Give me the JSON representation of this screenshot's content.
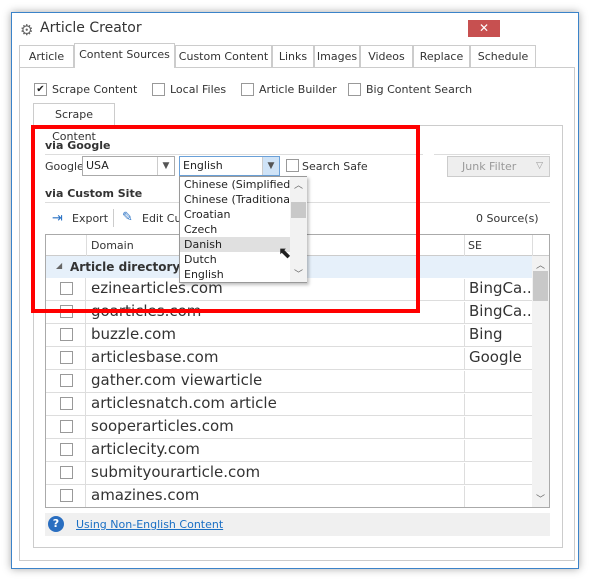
{
  "window": {
    "title": "Article Creator",
    "close_label": "✕"
  },
  "tabs": [
    {
      "label": "Article"
    },
    {
      "label": "Content Sources",
      "active": true
    },
    {
      "label": "Custom Content"
    },
    {
      "label": "Links"
    },
    {
      "label": "Images"
    },
    {
      "label": "Videos"
    },
    {
      "label": "Replace"
    },
    {
      "label": "Schedule"
    }
  ],
  "sources": [
    {
      "label": "Scrape Content",
      "checked": true
    },
    {
      "label": "Local Files",
      "checked": false
    },
    {
      "label": "Article Builder",
      "checked": false
    },
    {
      "label": "Big Content Search",
      "checked": false
    }
  ],
  "subtab": "Scrape Content",
  "google": {
    "section": "via Google",
    "label": "Google",
    "country": "USA",
    "language": "English",
    "search_safe": "Search Safe",
    "junk_filter": "Junk Filter"
  },
  "language_options": [
    "Chinese (Simplified)",
    "Chinese (Traditional)",
    "Croatian",
    "Czech",
    "Danish",
    "Dutch",
    "English"
  ],
  "hovered_option": "Danish",
  "custom": {
    "section": "via Custom Site",
    "export": "Export",
    "edit": "Edit Cu",
    "count": "0 Source(s)"
  },
  "grid": {
    "col_domain": "Domain",
    "col_se": "SE",
    "group": "Article directory",
    "rows": [
      {
        "domain": "ezinearticles.com",
        "se": "BingCa..."
      },
      {
        "domain": "goarticles.com",
        "se": "BingCa..."
      },
      {
        "domain": "buzzle.com",
        "se": "Bing"
      },
      {
        "domain": "articlesbase.com",
        "se": "Google"
      },
      {
        "domain": "gather.com viewarticle",
        "se": ""
      },
      {
        "domain": "articlesnatch.com article",
        "se": ""
      },
      {
        "domain": "sooperarticles.com",
        "se": ""
      },
      {
        "domain": "articlecity.com",
        "se": ""
      },
      {
        "domain": "submityourarticle.com",
        "se": ""
      },
      {
        "domain": "amazines.com",
        "se": ""
      }
    ]
  },
  "footer": {
    "link": "Using Non-English Content"
  },
  "colors": {
    "highlight": "#ff0000",
    "link": "#1a6fc4",
    "close": "#c75050",
    "group_bg": "#e6f0fa"
  }
}
